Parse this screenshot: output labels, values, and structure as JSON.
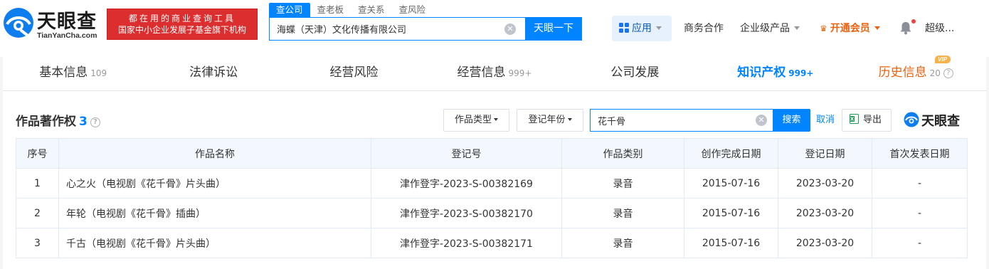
{
  "header": {
    "logo": {
      "cn": "天眼查",
      "en": "TianYanCha.com",
      "icon": "tianyancha-logo-icon"
    },
    "banner": {
      "line1": "都在用的商业查询工具",
      "line2": "国家中小企业发展子基金旗下机构"
    },
    "search_tabs": [
      "查公司",
      "查老板",
      "查关系",
      "查风险"
    ],
    "search": {
      "value": "海蝶（天津）文化传播有限公司",
      "button": "天眼一下"
    },
    "nav": {
      "apps": "应用",
      "business": "商务合作",
      "enterprise": "企业级产品",
      "vip": "开通会员",
      "user": "超级..."
    }
  },
  "tabs": [
    {
      "label": "基本信息",
      "count": "109"
    },
    {
      "label": "法律诉讼",
      "count": ""
    },
    {
      "label": "经营风险",
      "count": ""
    },
    {
      "label": "经营信息",
      "count": "999+"
    },
    {
      "label": "公司发展",
      "count": ""
    },
    {
      "label": "知识产权",
      "count": "999+",
      "active": true
    },
    {
      "label": "历史信息",
      "count": "20",
      "badge": "VIP"
    }
  ],
  "section": {
    "title": "作品著作权",
    "count": "3",
    "filters": {
      "type": "作品类型",
      "year": "登记年份"
    },
    "keyword": "花千骨",
    "search_btn": "搜索",
    "cancel": "取消",
    "export": "导出",
    "brand": "天眼查"
  },
  "table": {
    "columns": [
      "序号",
      "作品名称",
      "登记号",
      "作品类别",
      "创作完成日期",
      "登记日期",
      "首次发表日期"
    ],
    "rows": [
      [
        "1",
        "心之火（电视剧《花千骨》片头曲）",
        "津作登字-2023-S-00382169",
        "录音",
        "2015-07-16",
        "2023-03-20",
        "-"
      ],
      [
        "2",
        "年轮（电视剧《花千骨》插曲）",
        "津作登字-2023-S-00382170",
        "录音",
        "2015-07-16",
        "2023-03-20",
        "-"
      ],
      [
        "3",
        "千古（电视剧《花千骨》片头曲）",
        "津作登字-2023-S-00382171",
        "录音",
        "2015-07-16",
        "2023-03-20",
        "-"
      ]
    ]
  },
  "colors": {
    "primary": "#0084ff",
    "vip": "#e8620f",
    "banner": "#dc2e2e"
  }
}
